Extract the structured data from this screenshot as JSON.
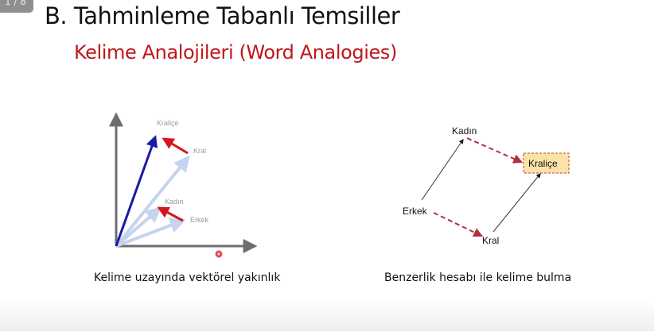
{
  "slide": {
    "page_indicator": "1 / 8",
    "title": "B. Tahminleme Tabanlı Temsiller",
    "subtitle": "Kelime Analojileri (Word Analogies)"
  },
  "left_figure": {
    "labels": {
      "queen": "Kraliçe",
      "king": "Kral",
      "woman": "Kadın",
      "man": "Erkek"
    },
    "caption": "Kelime uzayında vektörel yakınlık"
  },
  "right_figure": {
    "labels": {
      "woman": "Kadın",
      "queen": "Kraliçe",
      "man": "Erkek",
      "king": "Kral"
    },
    "caption": "Benzerlik hesabı ile kelime bulma"
  },
  "colors": {
    "title": "#111111",
    "subtitle": "#c0161b",
    "axis": "#6e6e6e",
    "vector_blue": "#1a1aa8",
    "vector_red": "#d8141c",
    "vector_light": "#c5d4ee",
    "highlight_box_fill": "#fbe3a8",
    "highlight_box_border": "#c0392b"
  }
}
